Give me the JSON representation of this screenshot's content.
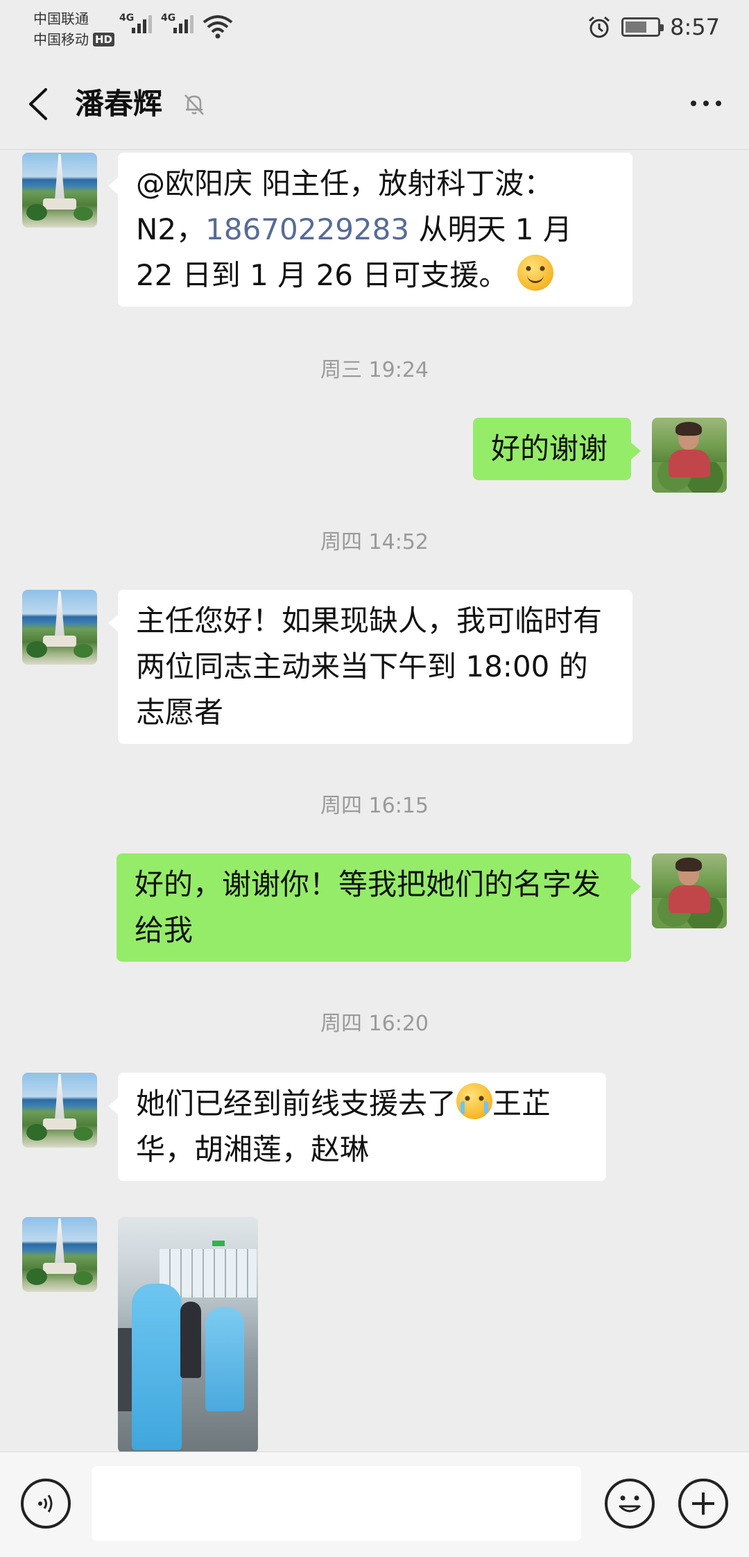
{
  "status_bar": {
    "carrier_1": "中国联通",
    "carrier_2": "中国移动",
    "hd_badge": "HD",
    "network_1": "4G",
    "network_2": "4G",
    "time": "8:57",
    "icons": [
      "signal-icon",
      "wifi-icon",
      "alarm-icon",
      "battery-icon"
    ]
  },
  "header": {
    "title": "潘春辉",
    "muted": true,
    "icons": [
      "back-arrow-icon",
      "bell-off-icon",
      "more-dots-icon"
    ]
  },
  "messages": [
    {
      "side": "left",
      "text_part1": "@欧阳庆  阳主任，放射科丁波：N2，",
      "phone": "18670229283",
      "text_part2": " 从明天 1 月 22 日到 1 月 26 日可支援。",
      "emoji": "smile-emoji-icon"
    },
    {
      "type": "time",
      "text": "周三 19:24"
    },
    {
      "side": "right",
      "text": "好的谢谢"
    },
    {
      "type": "time",
      "text": "周四 14:52"
    },
    {
      "side": "left",
      "text": "主任您好！如果现缺人，我可临时有两位同志主动来当下午到 18:00 的志愿者"
    },
    {
      "type": "time",
      "text": "周四 16:15"
    },
    {
      "side": "right",
      "text": "好的，谢谢你！等我把她们的名字发给我"
    },
    {
      "type": "time",
      "text": "周四 16:20"
    },
    {
      "side": "left",
      "text_part1": "她们已经到前线支援去了",
      "emoji": "crying-emoji-icon",
      "text_part2": "王芷华，胡湘莲，赵琳"
    },
    {
      "side": "left",
      "type": "image",
      "description_icon": "photo-message-icon"
    }
  ],
  "input_bar": {
    "value": "",
    "icons": [
      "voice-icon",
      "emoji-icon",
      "plus-icon"
    ]
  },
  "colors": {
    "chat_bg": "#ededed",
    "sent_bubble": "#95ec69",
    "received_bubble": "#ffffff",
    "link": "#576b95",
    "timestamp": "#9a9a9a"
  }
}
